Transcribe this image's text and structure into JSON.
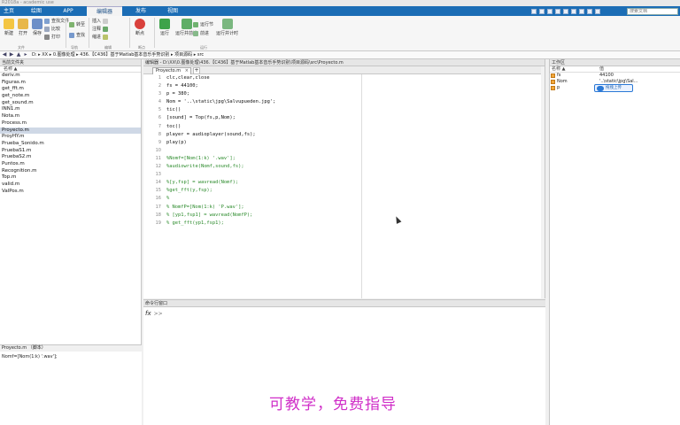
{
  "window": {
    "title": "R2018a - academic use"
  },
  "tabs": [
    "主页",
    "绘图",
    "APP",
    "编辑器",
    "发布",
    "视图"
  ],
  "active_tab": "编辑器",
  "search": {
    "placeholder": "搜索文档"
  },
  "ribbon": {
    "file_group": {
      "new": "新建",
      "open": "打开",
      "save": "保存",
      "find_files": "查找文件",
      "compare": "比较",
      "print": "打印",
      "label": "文件"
    },
    "nav_group": {
      "goto": "转至",
      "find": "查找",
      "label": "导航"
    },
    "edit_group": {
      "insert": "插入",
      "comment": "注释",
      "indent": "缩进",
      "label": "编辑"
    },
    "breakpoints_group": {
      "breakpoints": "断点",
      "label": "断点"
    },
    "run_group": {
      "run": "运行",
      "run_advance": "运行并前进",
      "run_section": "运行节",
      "advance": "前进",
      "run_time": "运行并计时",
      "label": "运行"
    }
  },
  "address": {
    "crumbs": [
      "D:",
      "XX",
      "0.图像处理",
      "436.【C436】基于Matlab基本音乐手势识别",
      "项目源码",
      "src"
    ]
  },
  "current_folder": {
    "header": "当前文件夹",
    "col_name": "名称 ▲",
    "files": [
      "deriv.m",
      "Figuras.m",
      "get_fft.m",
      "get_note.m",
      "get_sound.m",
      "INN1.m",
      "Nota.m",
      "Process.m",
      "Proyecto.m",
      "ProyHY.m",
      "Prueba_Sonido.m",
      "PruebaS1.m",
      "PruebaS2.m",
      "Puntos.m",
      "Recognition.m",
      "Top.m",
      "valid.m",
      "ValPos.m"
    ],
    "selected": "Proyecto.m"
  },
  "details": {
    "title": "Proyecto.m （脚本）",
    "body": "Nomf=[Nom(1:k) '.wav'];"
  },
  "editor": {
    "header": "编辑器 - D:\\XX\\0.图像处理\\436.【C436】基于Matlab基本音乐手势识别\\项目源码\\src\\Proyecto.m",
    "tab": "Proyecto.m",
    "close_glyph": "×",
    "plus": "+",
    "lines": [
      {
        "n": "1",
        "t": "clc,clear,close",
        "c": false
      },
      {
        "n": "2",
        "t": "fs = 44100;",
        "c": false
      },
      {
        "n": "3",
        "t": "p = 380;",
        "c": false
      },
      {
        "n": "4",
        "t": "Nom = '..\\static\\jpg\\Salvupueden.jpg';",
        "c": false
      },
      {
        "n": "5",
        "t": "tic()",
        "c": false
      },
      {
        "n": "6",
        "t": "[sound] = Top(fs,p,Nom);",
        "c": false
      },
      {
        "n": "7",
        "t": "toc()",
        "c": false
      },
      {
        "n": "8",
        "t": "player = audioplayer(sound,fs);",
        "c": false
      },
      {
        "n": "9",
        "t": "play(p)",
        "c": false
      },
      {
        "n": "10",
        "t": "",
        "c": false
      },
      {
        "n": "11",
        "t": "%Nomf=[Nom(1:k) '.wav'];",
        "c": true
      },
      {
        "n": "12",
        "t": "%audiowrite(Nomf,sound,fs);",
        "c": true
      },
      {
        "n": "13",
        "t": "",
        "c": false
      },
      {
        "n": "14",
        "t": "%[y,fsp] = wavread(Nomf);",
        "c": true
      },
      {
        "n": "15",
        "t": "%get_fft(y,fsp);",
        "c": true
      },
      {
        "n": "16",
        "t": "%",
        "c": true
      },
      {
        "n": "17",
        "t": "% NomfP=[Nom(1:k) 'P.wav'];",
        "c": true
      },
      {
        "n": "18",
        "t": "% [yp1,fsp1] = wavread(NomfP);",
        "c": true
      },
      {
        "n": "19",
        "t": "% get_fft(yp1,fsp1);",
        "c": true
      }
    ]
  },
  "command_window": {
    "header": "命令行窗口",
    "fx": "fx",
    "prompt": ">>"
  },
  "workspace": {
    "header": "工作区",
    "col_name": "名称 ▲",
    "col_value": "值",
    "vars": [
      {
        "name": "fs",
        "value": "44100"
      },
      {
        "name": "Nom",
        "value": "'..\\static\\jpg\\Sal..."
      },
      {
        "name": "p",
        "value": "380"
      }
    ]
  },
  "upload_popup": {
    "label": "拖拽上传"
  },
  "caption": "可教学，免费指导"
}
